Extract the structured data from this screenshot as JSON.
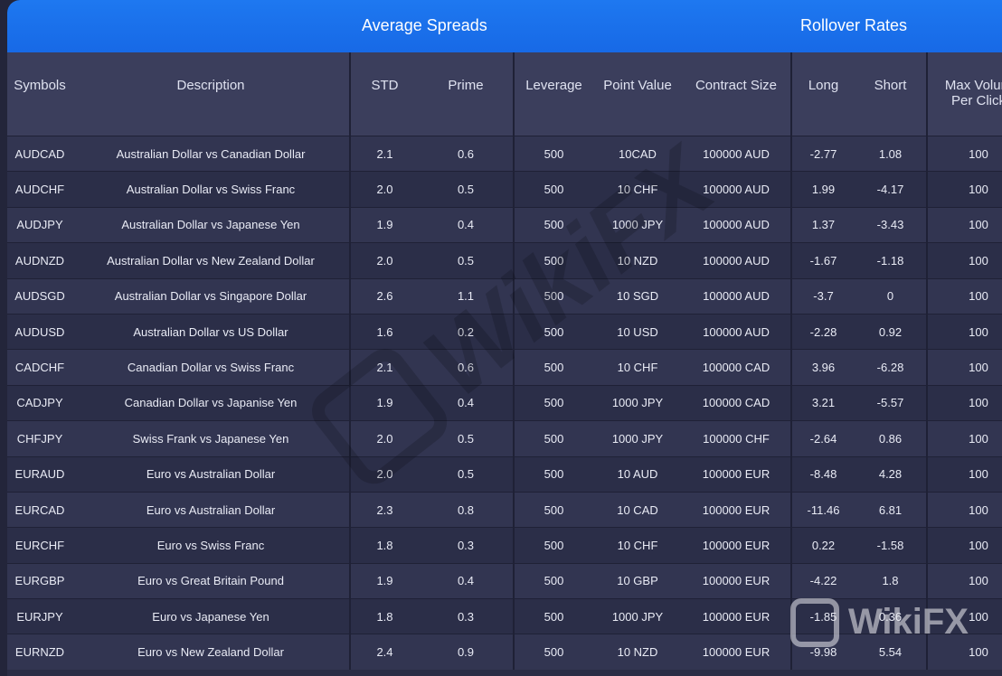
{
  "banner": {
    "average_spreads": "Average Spreads",
    "rollover_rates": "Rollover Rates"
  },
  "columns": [
    "Symbols",
    "Description",
    "STD",
    "Prime",
    "Leverage",
    "Point Value",
    "Contract Size",
    "Long",
    "Short",
    "Max Volum",
    "Per Click"
  ],
  "rows": [
    [
      "AUDCAD",
      "Australian Dollar vs Canadian Dollar",
      "2.1",
      "0.6",
      "500",
      "10CAD",
      "100000 AUD",
      "-2.77",
      "1.08",
      "100"
    ],
    [
      "AUDCHF",
      "Australian Dollar vs Swiss Franc",
      "2.0",
      "0.5",
      "500",
      "10 CHF",
      "100000 AUD",
      "1.99",
      "-4.17",
      "100"
    ],
    [
      "AUDJPY",
      "Australian Dollar vs Japanese Yen",
      "1.9",
      "0.4",
      "500",
      "1000 JPY",
      "100000 AUD",
      "1.37",
      "-3.43",
      "100"
    ],
    [
      "AUDNZD",
      "Australian Dollar vs New Zealand Dollar",
      "2.0",
      "0.5",
      "500",
      "10 NZD",
      "100000 AUD",
      "-1.67",
      "-1.18",
      "100"
    ],
    [
      "AUDSGD",
      "Australian Dollar vs Singapore Dollar",
      "2.6",
      "1.1",
      "500",
      "10 SGD",
      "100000 AUD",
      "-3.7",
      "0",
      "100"
    ],
    [
      "AUDUSD",
      "Australian Dollar vs US Dollar",
      "1.6",
      "0.2",
      "500",
      "10 USD",
      "100000 AUD",
      "-2.28",
      "0.92",
      "100"
    ],
    [
      "CADCHF",
      "Canadian Dollar vs Swiss Franc",
      "2.1",
      "0.6",
      "500",
      "10 CHF",
      "100000 CAD",
      "3.96",
      "-6.28",
      "100"
    ],
    [
      "CADJPY",
      "Canadian Dollar vs Japanise Yen",
      "1.9",
      "0.4",
      "500",
      "1000 JPY",
      "100000 CAD",
      "3.21",
      "-5.57",
      "100"
    ],
    [
      "CHFJPY",
      "Swiss Frank vs Japanese Yen",
      "2.0",
      "0.5",
      "500",
      "1000 JPY",
      "100000 CHF",
      "-2.64",
      "0.86",
      "100"
    ],
    [
      "EURAUD",
      "Euro vs Australian Dollar",
      "2.0",
      "0.5",
      "500",
      "10 AUD",
      "100000 EUR",
      "-8.48",
      "4.28",
      "100"
    ],
    [
      "EURCAD",
      "Euro vs Australian Dollar",
      "2.3",
      "0.8",
      "500",
      "10 CAD",
      "100000 EUR",
      "-11.46",
      "6.81",
      "100"
    ],
    [
      "EURCHF",
      "Euro vs Swiss Franc",
      "1.8",
      "0.3",
      "500",
      "10 CHF",
      "100000 EUR",
      "0.22",
      "-1.58",
      "100"
    ],
    [
      "EURGBP",
      "Euro vs Great Britain Pound",
      "1.9",
      "0.4",
      "500",
      "10 GBP",
      "100000 EUR",
      "-4.22",
      "1.8",
      "100"
    ],
    [
      "EURJPY",
      "Euro vs Japanese Yen",
      "1.8",
      "0.3",
      "500",
      "1000 JPY",
      "100000 EUR",
      "-1.85",
      "0.36",
      "100"
    ],
    [
      "EURNZD",
      "Euro vs New Zealand Dollar",
      "2.4",
      "0.9",
      "500",
      "10 NZD",
      "100000 EUR",
      "-9.98",
      "5.54",
      "100"
    ]
  ],
  "watermark": {
    "text": "WikiFX"
  }
}
